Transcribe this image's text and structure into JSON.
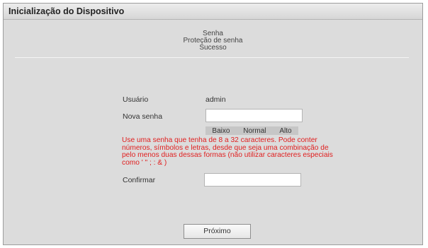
{
  "dialog": {
    "title": "Inicialização do Dispositivo"
  },
  "steps": [
    "Senha",
    "Proteção de senha",
    "Sucesso"
  ],
  "form": {
    "user_label": "Usuário",
    "user_value": "admin",
    "new_password_label": "Nova senha",
    "new_password_value": "",
    "strength_levels": [
      "Baixo",
      "Normal",
      "Alto"
    ],
    "hint": "Use uma senha que tenha de 8 a 32 caracteres. Pode conter números, símbolos e letras, desde que seja uma combinação de pelo menos duas dessas formas (não utilizar caracteres especiais como ' \" ; : & )",
    "confirm_label": "Confirmar",
    "confirm_value": ""
  },
  "buttons": {
    "next_label": "Próximo"
  },
  "colors": {
    "hint": "#e02020",
    "dialog_bg": "#dcdcdc",
    "strength_bar": "#c6c6c6"
  }
}
